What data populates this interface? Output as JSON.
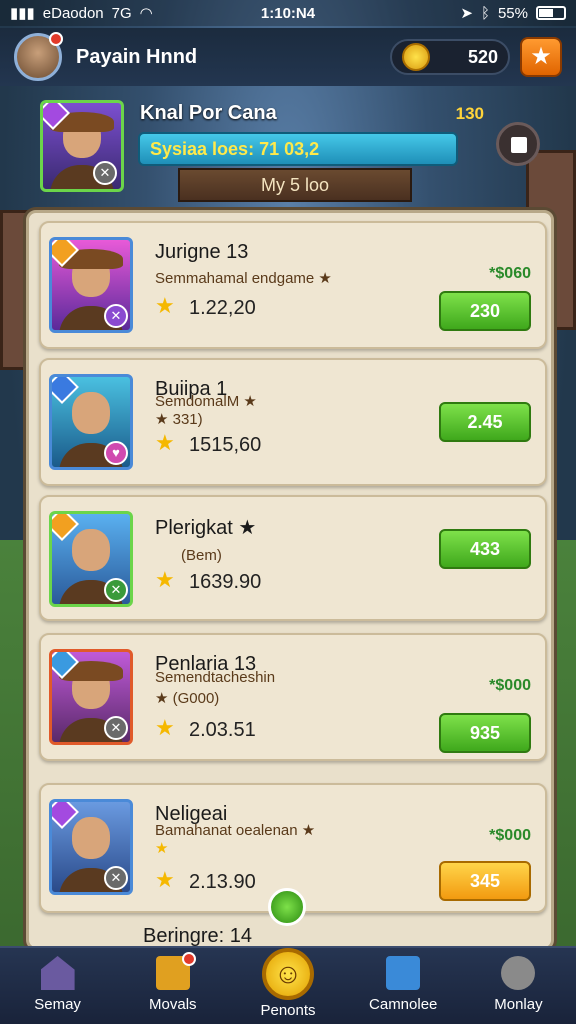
{
  "status_bar": {
    "carrier": "eDaodon",
    "network": "7G",
    "time": "1:10:N4",
    "battery": "55%"
  },
  "header": {
    "player_name": "Payain Hnnd",
    "coins": "520"
  },
  "profile": {
    "title": "Knal Por Cana",
    "value": "130",
    "stats": "Sysiaa  loes: 71 03,2",
    "ribbon": "My 5 loo"
  },
  "cards": [
    {
      "name": "Jurigne 13",
      "subtitle": "Semmahamal endgame ★",
      "extra": "",
      "stat": "1.22,20",
      "reward": "*$060",
      "price": "230",
      "btn": "green"
    },
    {
      "name": "Buiipa 1",
      "subtitle": "SemdomalM ★",
      "extra": "★ 331)",
      "stat": "1515,60",
      "reward": "",
      "price": "2.45",
      "btn": "green"
    },
    {
      "name": "Plerigkat ★",
      "subtitle": "",
      "extra": "(Bem)",
      "stat": "1639.90",
      "reward": "",
      "price": "433",
      "btn": "green"
    },
    {
      "name": "Penlaria 13",
      "subtitle": "Semendtacheshin",
      "extra": "★ (G000)",
      "stat": "2.03.51",
      "reward": "*$000",
      "price": "935",
      "btn": "green"
    },
    {
      "name": "Neligeai",
      "subtitle": "Bamahanat oealenan ★",
      "extra": "★",
      "stat": "2.13.90",
      "reward": "*$000",
      "price": "345",
      "btn": "gold"
    }
  ],
  "next_card": {
    "name": "Beringre: 14"
  },
  "nav": [
    "Semay",
    "Movals",
    "Penonts",
    "Camnolee",
    "Monlay"
  ]
}
